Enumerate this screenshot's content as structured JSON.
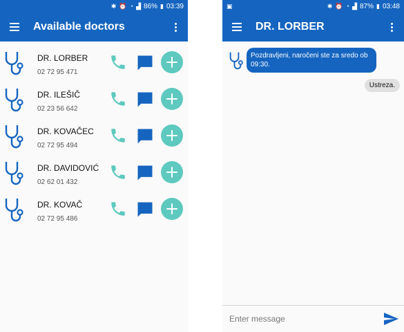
{
  "left_screen": {
    "statusbar": {
      "battery": "86%",
      "time": "03:39"
    },
    "appbar": {
      "title": "Available doctors"
    },
    "doctors": [
      {
        "name": "DR. LORBER",
        "phone": "02 72 95 471"
      },
      {
        "name": "DR. ILEŠIČ",
        "phone": "02 23 56 642"
      },
      {
        "name": "DR. KOVAČEC",
        "phone": "02 72 95 494"
      },
      {
        "name": "DR. DAVIDOVIĆ",
        "phone": "02 62 01 432"
      },
      {
        "name": "DR. KOVAČ",
        "phone": "02 72 95 486"
      }
    ]
  },
  "right_screen": {
    "statusbar": {
      "battery": "87%",
      "time": "03:48"
    },
    "appbar": {
      "title": "DR. LORBER"
    },
    "messages": {
      "incoming": "Pozdravljeni, naročeni ste za sredo ob 09:30.",
      "outgoing": "Ustreza."
    },
    "input": {
      "placeholder": "Enter message"
    }
  },
  "colors": {
    "primary": "#1565c0",
    "accent": "#5ec9bf",
    "background": "#fafafa"
  },
  "icons": {
    "doctor_avatar": "stethoscope-icon",
    "call": "phone-icon",
    "message": "chat-bubble-icon",
    "add": "add-circle-icon",
    "send": "send-icon"
  }
}
